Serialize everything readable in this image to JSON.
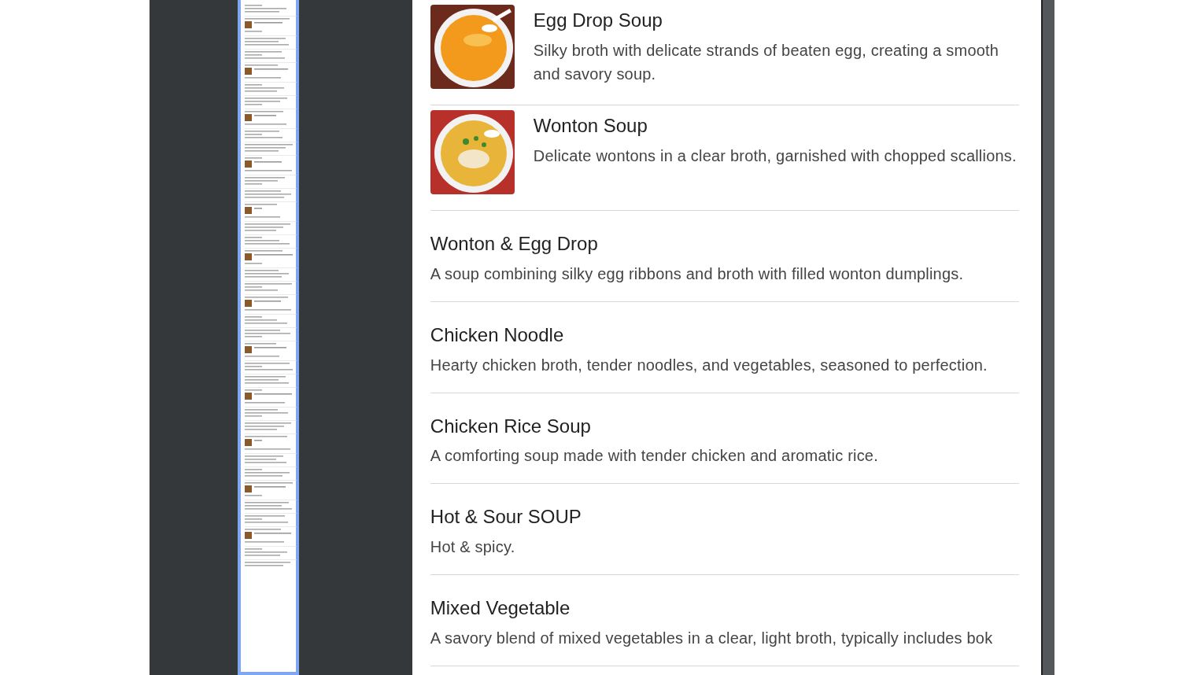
{
  "thumbnail_sidebar": {
    "pages": [
      {
        "selected": true
      }
    ]
  },
  "menu_items": [
    {
      "name": "Egg Drop Soup",
      "description": "Silky broth with delicate strands of beaten egg, creating a smooth and savory soup.",
      "kind": "picture"
    },
    {
      "name": "Wonton Soup",
      "description": "Delicate wontons in a clear broth, garnished with chopped scallions.",
      "kind": "picture"
    },
    {
      "name": "Wonton & Egg Drop",
      "description": "A soup combining silky egg ribbons and broth with filled wonton dumplings."
    },
    {
      "name": "Chicken Noodle",
      "description": "Hearty chicken broth, tender noodles, and vegetables, seasoned to perfection."
    },
    {
      "name": "Chicken Rice Soup",
      "description": "A comforting soup made with tender chicken and aromatic rice."
    },
    {
      "name": "Hot & Sour SOUP",
      "description": "Hot & spicy."
    },
    {
      "name": "Mixed Vegetable",
      "description": "A savory blend of mixed vegetables in a clear, light broth, typically includes bok"
    }
  ]
}
